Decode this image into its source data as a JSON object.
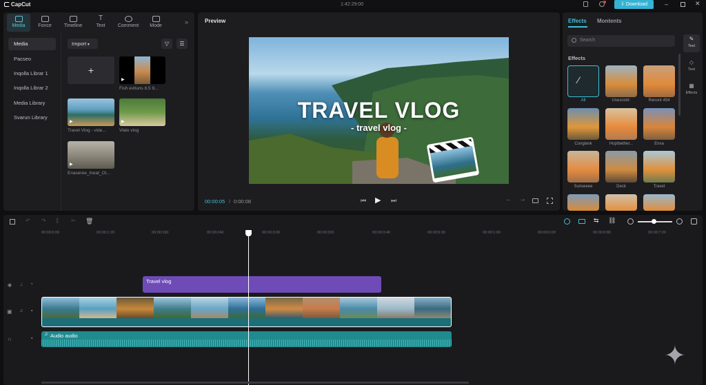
{
  "app": {
    "name": "CapCut",
    "timecode": "1:42:29:00",
    "download_label": "Download"
  },
  "media_tabs": [
    {
      "label": "Media",
      "icon": "folder-icon"
    },
    {
      "label": "Fonce",
      "icon": "image-icon"
    },
    {
      "label": "Timeline",
      "icon": "timeline-icon"
    },
    {
      "label": "Text",
      "icon": "text-icon"
    },
    {
      "label": "Comment",
      "icon": "comment-icon"
    },
    {
      "label": "Mode",
      "icon": "mode-icon"
    }
  ],
  "sidebar": {
    "items": [
      "Media",
      "Pacseo",
      "Inqolla Librar 1",
      "Inqolla Librar 2",
      "Media Library",
      "Svarun Library"
    ]
  },
  "import_label": "Import",
  "media_items": [
    {
      "label": "Fish evituns 8.5 9..."
    },
    {
      "label": "Travel Vlog - vide..."
    },
    {
      "label": "Vlalo vlog"
    },
    {
      "label": "Enaseree_Ineat_Ol..."
    }
  ],
  "preview": {
    "title": "Preview",
    "overlay_title": "TRAVEL VLOG",
    "overlay_sub": "- travel vlog -",
    "current_time": "00:00:05",
    "separator": "/",
    "total_time": "0:00:08"
  },
  "effects_panel": {
    "tabs": [
      "Effects",
      "Montents"
    ],
    "search_placeholder": "Search",
    "section": "Effects",
    "items": [
      "All",
      "Unesnotir:",
      "Renont 454",
      "Conglank",
      "Hoptbether...",
      "Enva",
      "Sunseeee",
      "Deck",
      "Travet",
      "",
      "",
      ""
    ],
    "rail": [
      "Text",
      "Text",
      "Effects"
    ]
  },
  "timeline": {
    "ticks": [
      "00:00:0:00",
      "00:00:1:20",
      "00:00:190",
      "00:00:240",
      "00:00:3:00",
      "00:00:320",
      "00:00:3:40",
      "00:00:5:00",
      "00:00:1:00",
      "00:00:6:00",
      "00:00:6:80",
      "00:00:7:20"
    ],
    "text_clip": "Travel vlog",
    "audio_clip": "Audio audio"
  },
  "colors": {
    "accent": "#3fc1d6",
    "text_clip": "#6f4bb8",
    "audio_clip": "#1f8b8f"
  }
}
